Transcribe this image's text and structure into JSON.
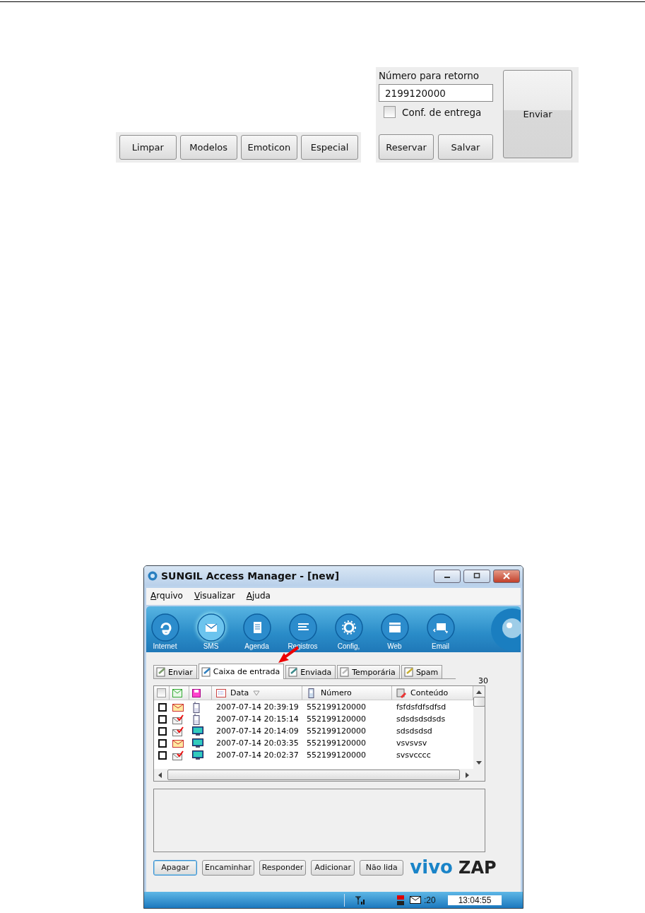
{
  "compose_panel": {
    "edit_buttons": [
      {
        "label": "Limpar"
      },
      {
        "label": "Modelos"
      },
      {
        "label": "Emoticon"
      },
      {
        "label": "Especial"
      }
    ],
    "return_number": {
      "label": "Número para retorno",
      "value": "2199120000"
    },
    "delivery_confirmation": {
      "label": "Conf. de entrega",
      "checked": false
    },
    "save_buttons": [
      {
        "label": "Reservar"
      },
      {
        "label": "Salvar"
      }
    ],
    "send_button": "Enviar"
  },
  "window": {
    "title": "SUNGIL Access Manager - [new]",
    "menu": [
      {
        "label": "Arquivo"
      },
      {
        "label": "Visualizar"
      },
      {
        "label": "Ajuda"
      }
    ],
    "toolbar": [
      {
        "label": "Internet",
        "kind": "internet",
        "selected": false
      },
      {
        "label": "SMS",
        "kind": "sms",
        "selected": true
      },
      {
        "label": "Agenda",
        "kind": "agenda",
        "selected": false
      },
      {
        "label": "Registros",
        "kind": "registros",
        "selected": false
      },
      {
        "label": "Config,",
        "kind": "config",
        "selected": false
      },
      {
        "label": "Web",
        "kind": "web",
        "selected": false
      },
      {
        "label": "Email",
        "kind": "email",
        "selected": false
      }
    ],
    "tabs": [
      {
        "label": "Enviar",
        "kind": "send",
        "selected": false
      },
      {
        "label": "Caixa de entrada",
        "kind": "inbox",
        "selected": true
      },
      {
        "label": "Enviada",
        "kind": "sent",
        "selected": false
      },
      {
        "label": "Temporária",
        "kind": "temp",
        "selected": false
      },
      {
        "label": "Spam",
        "kind": "spam",
        "selected": false
      }
    ],
    "message_count": "30",
    "table": {
      "select_all_checked": false,
      "columns": [
        {
          "label": "Data",
          "kind": "date",
          "sorted": true
        },
        {
          "label": "Número",
          "kind": "number",
          "sorted": false
        },
        {
          "label": "Conteúdo",
          "kind": "content",
          "sorted": false
        }
      ],
      "rows": [
        {
          "checked": false,
          "replied": false,
          "from_pc": false,
          "date": "2007-07-14 20:39:19",
          "number": "552199120000",
          "content": "fsfdsfdfsdfsd"
        },
        {
          "checked": false,
          "replied": true,
          "from_pc": false,
          "date": "2007-07-14 20:15:14",
          "number": "552199120000",
          "content": "sdsdsdsdsds"
        },
        {
          "checked": false,
          "replied": true,
          "from_pc": true,
          "date": "2007-07-14 20:14:09",
          "number": "552199120000",
          "content": "sdsdsdsd"
        },
        {
          "checked": false,
          "replied": false,
          "from_pc": true,
          "date": "2007-07-14 20:03:35",
          "number": "552199120000",
          "content": "vsvsvsv"
        },
        {
          "checked": false,
          "replied": true,
          "from_pc": true,
          "date": "2007-07-14 20:02:37",
          "number": "552199120000",
          "content": "svsvcccc"
        }
      ]
    },
    "action_buttons": [
      {
        "label": "Apagar",
        "focused": true
      },
      {
        "label": "Encaminhar",
        "focused": false
      },
      {
        "label": "Responder",
        "focused": false
      },
      {
        "label": "Adicionar",
        "focused": false
      },
      {
        "label": "Não lida",
        "focused": false
      }
    ],
    "brand": {
      "first": "vivo",
      "second": "ZAP"
    },
    "status_bar": {
      "message_count": ":20",
      "time": "13:04:55"
    }
  }
}
